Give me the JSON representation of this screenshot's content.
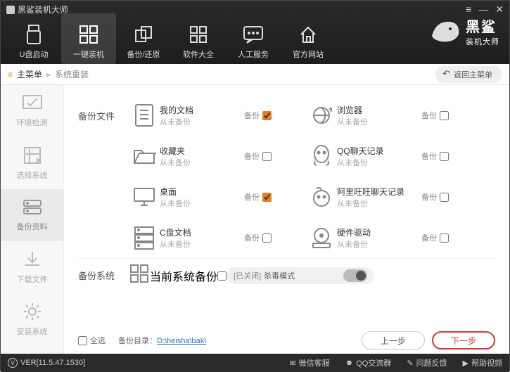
{
  "window": {
    "title": "黑鲨装机大师"
  },
  "nav": {
    "items": [
      {
        "label": "U盘启动"
      },
      {
        "label": "一键装机"
      },
      {
        "label": "备份/还原"
      },
      {
        "label": "软件大全"
      },
      {
        "label": "人工服务"
      },
      {
        "label": "官方网站"
      }
    ],
    "active_index": 1
  },
  "brand": {
    "name": "黑鲨",
    "tagline": "装机大师"
  },
  "breadcrumb": {
    "root": "主菜单",
    "current": "系统重装",
    "return_label": "返回主菜单"
  },
  "sidebar_steps": [
    {
      "label": "环境检测"
    },
    {
      "label": "选择系统"
    },
    {
      "label": "备份资料"
    },
    {
      "label": "下载文件"
    },
    {
      "label": "安装系统"
    }
  ],
  "sidebar_active_index": 2,
  "sections": {
    "files_title": "备份文件",
    "system_title": "备份系统",
    "never_backed_up": "从未备份",
    "checkbox_label": "备份"
  },
  "backup_items": {
    "left": [
      {
        "name": "我的文档",
        "checked": true
      },
      {
        "name": "收藏夹",
        "checked": false
      },
      {
        "name": "桌面",
        "checked": true
      },
      {
        "name": "C盘文档",
        "checked": false
      }
    ],
    "right": [
      {
        "name": "浏览器",
        "checked": false
      },
      {
        "name": "QQ聊天记录",
        "checked": false
      },
      {
        "name": "阿里旺旺聊天记录",
        "checked": false
      },
      {
        "name": "硬件驱动",
        "checked": false
      }
    ]
  },
  "system_row": {
    "name": "当前系统",
    "checked": false
  },
  "antivirus": {
    "status_prefix": "[已关闭]",
    "label": "杀毒模式",
    "on": false
  },
  "footer": {
    "select_all": "全选",
    "backup_dir_label": "备份目录：",
    "backup_dir_path": "D:\\heisha\\bak\\",
    "prev": "上一步",
    "next": "下一步"
  },
  "statusbar": {
    "version": "VER[11.5.47.1530]",
    "links": [
      {
        "label": "微信客服"
      },
      {
        "label": "QQ交流群"
      },
      {
        "label": "问题反馈"
      },
      {
        "label": "帮助视频"
      }
    ]
  }
}
